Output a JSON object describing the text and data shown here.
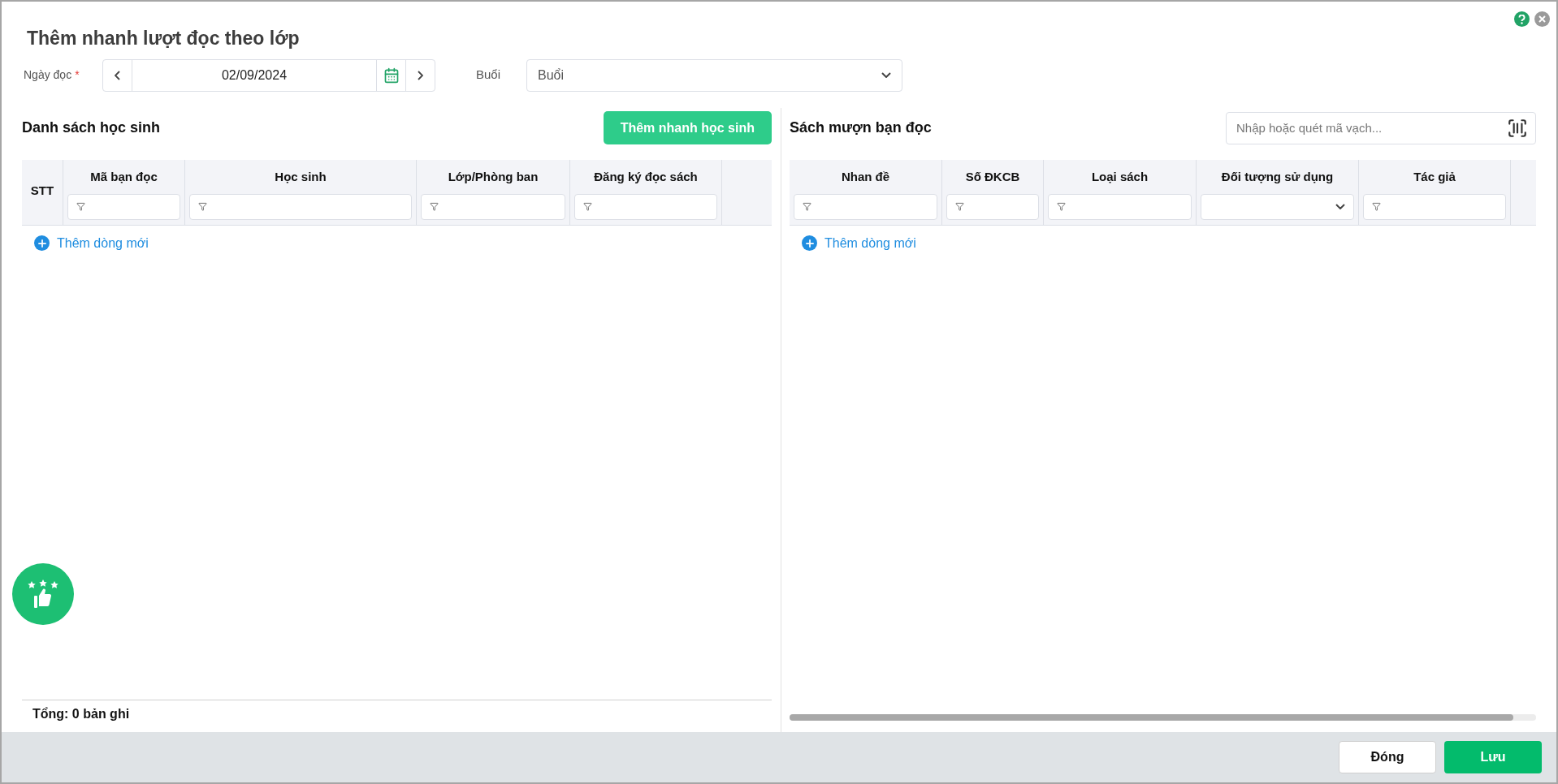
{
  "dialog": {
    "title": "Thêm nhanh lượt đọc theo lớp"
  },
  "date_field": {
    "label": "Ngày đọc",
    "required_mark": "*",
    "value": "02/09/2024"
  },
  "session_field": {
    "label": "Buổi",
    "value": "Buổi"
  },
  "students": {
    "title": "Danh sách học sinh",
    "add_button": "Thêm nhanh học sinh",
    "columns": [
      {
        "label": "STT",
        "kind": "plain"
      },
      {
        "label": "Mã bạn đọc",
        "kind": "text_filter"
      },
      {
        "label": "Học sinh",
        "kind": "text_filter"
      },
      {
        "label": "Lớp/Phòng ban",
        "kind": "text_filter"
      },
      {
        "label": "Đăng ký đọc sách",
        "kind": "text_filter"
      }
    ],
    "add_row": "Thêm dòng mới",
    "total": "Tổng: 0 bản ghi"
  },
  "books": {
    "title": "Sách mượn bạn đọc",
    "barcode_placeholder": "Nhập hoặc quét mã vạch...",
    "columns": [
      {
        "label": "Nhan đề",
        "kind": "text_filter"
      },
      {
        "label": "Số ĐKCB",
        "kind": "text_filter"
      },
      {
        "label": "Loại sách",
        "kind": "text_filter"
      },
      {
        "label": "Đối tượng sử dụng",
        "kind": "select_filter"
      },
      {
        "label": "Tác giả",
        "kind": "text_filter"
      }
    ],
    "add_row": "Thêm dòng mới"
  },
  "buttons": [
    {
      "label": "Đóng",
      "kind": "secondary"
    },
    {
      "label": "Lưu",
      "kind": "primary"
    }
  ]
}
